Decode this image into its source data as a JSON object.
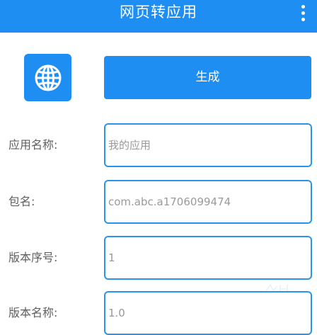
{
  "header": {
    "title": "网页转应用",
    "background": "#1e8ef2",
    "menu_icon": "more-vert-icon"
  },
  "app_icon": {
    "icon": "globe-icon",
    "background": "#1e8ef2"
  },
  "generate_button": {
    "label": "生成",
    "background": "#1e8ef2"
  },
  "form": {
    "app_name": {
      "label": "应用名称:",
      "value": "",
      "placeholder": "我的应用"
    },
    "package_name": {
      "label": "包名:",
      "value": "",
      "placeholder": "com.abc.a1706099474"
    },
    "version_code": {
      "label": "版本序号:",
      "value": "",
      "placeholder": "1"
    },
    "version_name": {
      "label": "版本名称:",
      "value": "",
      "placeholder": "1.0"
    }
  },
  "colors": {
    "accent": "#1e8ef2",
    "field_border": "#2a94ea",
    "label_text": "#5f5f5f",
    "placeholder_text": "#9a9a9a"
  }
}
